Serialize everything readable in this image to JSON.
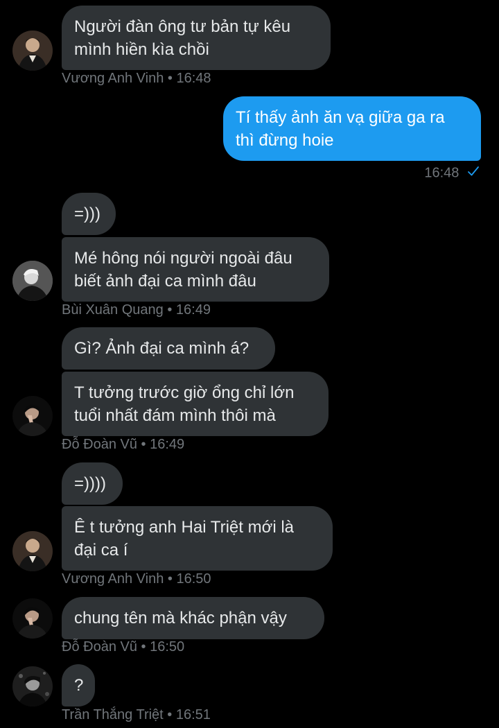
{
  "messages": [
    {
      "text_lines": [
        "Người đàn ông tư bản tự kêu",
        "mình hiền kìa chồi"
      ],
      "sender": "Vương Anh Vinh",
      "time": "16:48"
    },
    {
      "text_lines": [
        "Tí thấy ảnh ăn vạ giữa ga ra",
        "thì đừng hoie"
      ],
      "time": "16:48",
      "direction": "outgoing"
    },
    {
      "text_lines": [
        "=)))"
      ]
    },
    {
      "text_lines": [
        "Mé hông nói người ngoài đâu",
        "biết ảnh đại ca mình đâu"
      ],
      "sender": "Bùi Xuân Quang",
      "time": "16:49"
    },
    {
      "text_lines": [
        "Gì? Ảnh đại ca mình á?"
      ]
    },
    {
      "text_lines": [
        "T tưởng trước giờ ổng chỉ lớn",
        "tuổi nhất đám mình thôi mà"
      ],
      "sender": "Đỗ Đoàn Vũ",
      "time": "16:49"
    },
    {
      "text_lines": [
        "=))))"
      ]
    },
    {
      "text_lines": [
        "Ê t tưởng anh Hai Triệt mới là",
        "đại ca í"
      ],
      "sender": "Vương Anh Vinh",
      "time": "16:50"
    },
    {
      "text_lines": [
        "chung tên mà khác phận vậy"
      ],
      "sender": "Đỗ Đoàn Vũ",
      "time": "16:50"
    },
    {
      "text_lines": [
        "?"
      ],
      "sender": "Trần Thắng Triệt",
      "time": "16:51"
    }
  ],
  "meta": {
    "m0": "Vương Anh Vinh • 16:48",
    "m1": "16:48",
    "m3": "Bùi Xuân Quang • 16:49",
    "m5": "Đỗ Đoàn Vũ • 16:49",
    "m7": "Vương Anh Vinh • 16:50",
    "m8": "Đỗ Đoàn Vũ • 16:50",
    "m9": "Trần Thắng Triệt • 16:51"
  },
  "colors": {
    "background": "#000000",
    "incoming_bubble": "#2f3336",
    "outgoing_bubble": "#1d9bf0",
    "meta_text": "#71767b",
    "read_check": "#1d9bf0"
  },
  "icons": {
    "read_receipt": "check-icon"
  }
}
